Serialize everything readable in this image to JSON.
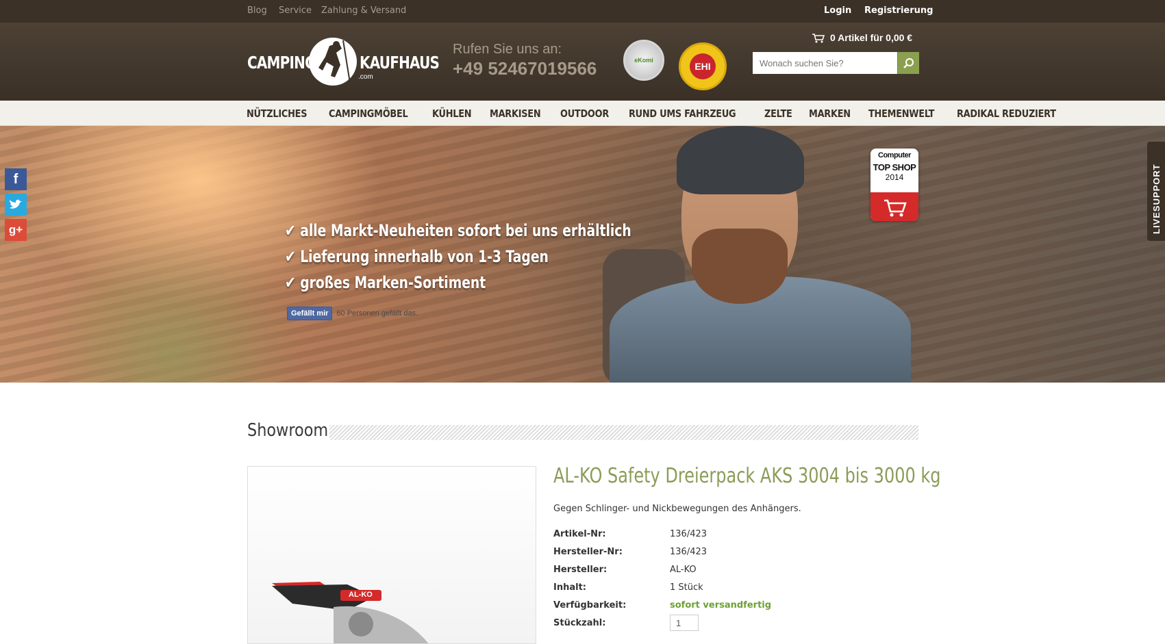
{
  "topbar": {
    "links": [
      "Blog",
      "Service",
      "Zahlung & Versand"
    ],
    "login": "Login",
    "register": "Registrierung"
  },
  "header": {
    "logo_left": "CAMPING-",
    "logo_right": "KAUFHAUS",
    "logo_suffix": ".com",
    "phone_label": "Rufen Sie uns an:",
    "phone_number": "+49 52467019566",
    "badge_ekomi": "eKomi",
    "badge_ehi": "EHI",
    "cart": "0 Artikel für 0,00 €",
    "search_placeholder": "Wonach suchen Sie?"
  },
  "nav": [
    "NÜTZLICHES",
    "CAMPINGMÖBEL",
    "KÜHLEN",
    "MARKISEN",
    "OUTDOOR",
    "RUND UMS FAHRZEUG",
    "ZELTE",
    "MARKEN",
    "THEMENWELT",
    "RADIKAL REDUZIERT"
  ],
  "hero": {
    "features": [
      "alle Markt-Neuheiten sofort bei uns erhältlich",
      "Lieferung innerhalb von 1-3 Tagen",
      "großes Marken-Sortiment"
    ],
    "fb_like": "Gefällt mir",
    "fb_count": "60 Personen gefällt das.",
    "topshop": {
      "brand": "Computer",
      "title": "TOP SHOP",
      "year": "2014"
    }
  },
  "livesupport": "LIVESUPPORT",
  "content": {
    "section_title": "Showroom",
    "product_title": "AL-KO Safety Dreierpack AKS 3004 bis 3000 kg",
    "description": "Gegen Schlinger- und Nickbewegungen des Anhängers.",
    "image_brand": "AL-KO",
    "specs": [
      {
        "label": "Artikel-Nr:",
        "value": "136/423"
      },
      {
        "label": "Hersteller-Nr:",
        "value": "136/423"
      },
      {
        "label": "Hersteller:",
        "value": "AL-KO"
      },
      {
        "label": "Inhalt:",
        "value": "1 Stück"
      },
      {
        "label": "Verfügbarkeit:",
        "value": "sofort versandfertig"
      },
      {
        "label": "Stückzahl:",
        "value": ""
      }
    ],
    "quantity": "1"
  },
  "colors": {
    "brown": "#3b3127",
    "accent_green": "#8b9c58",
    "available": "#6da033"
  }
}
